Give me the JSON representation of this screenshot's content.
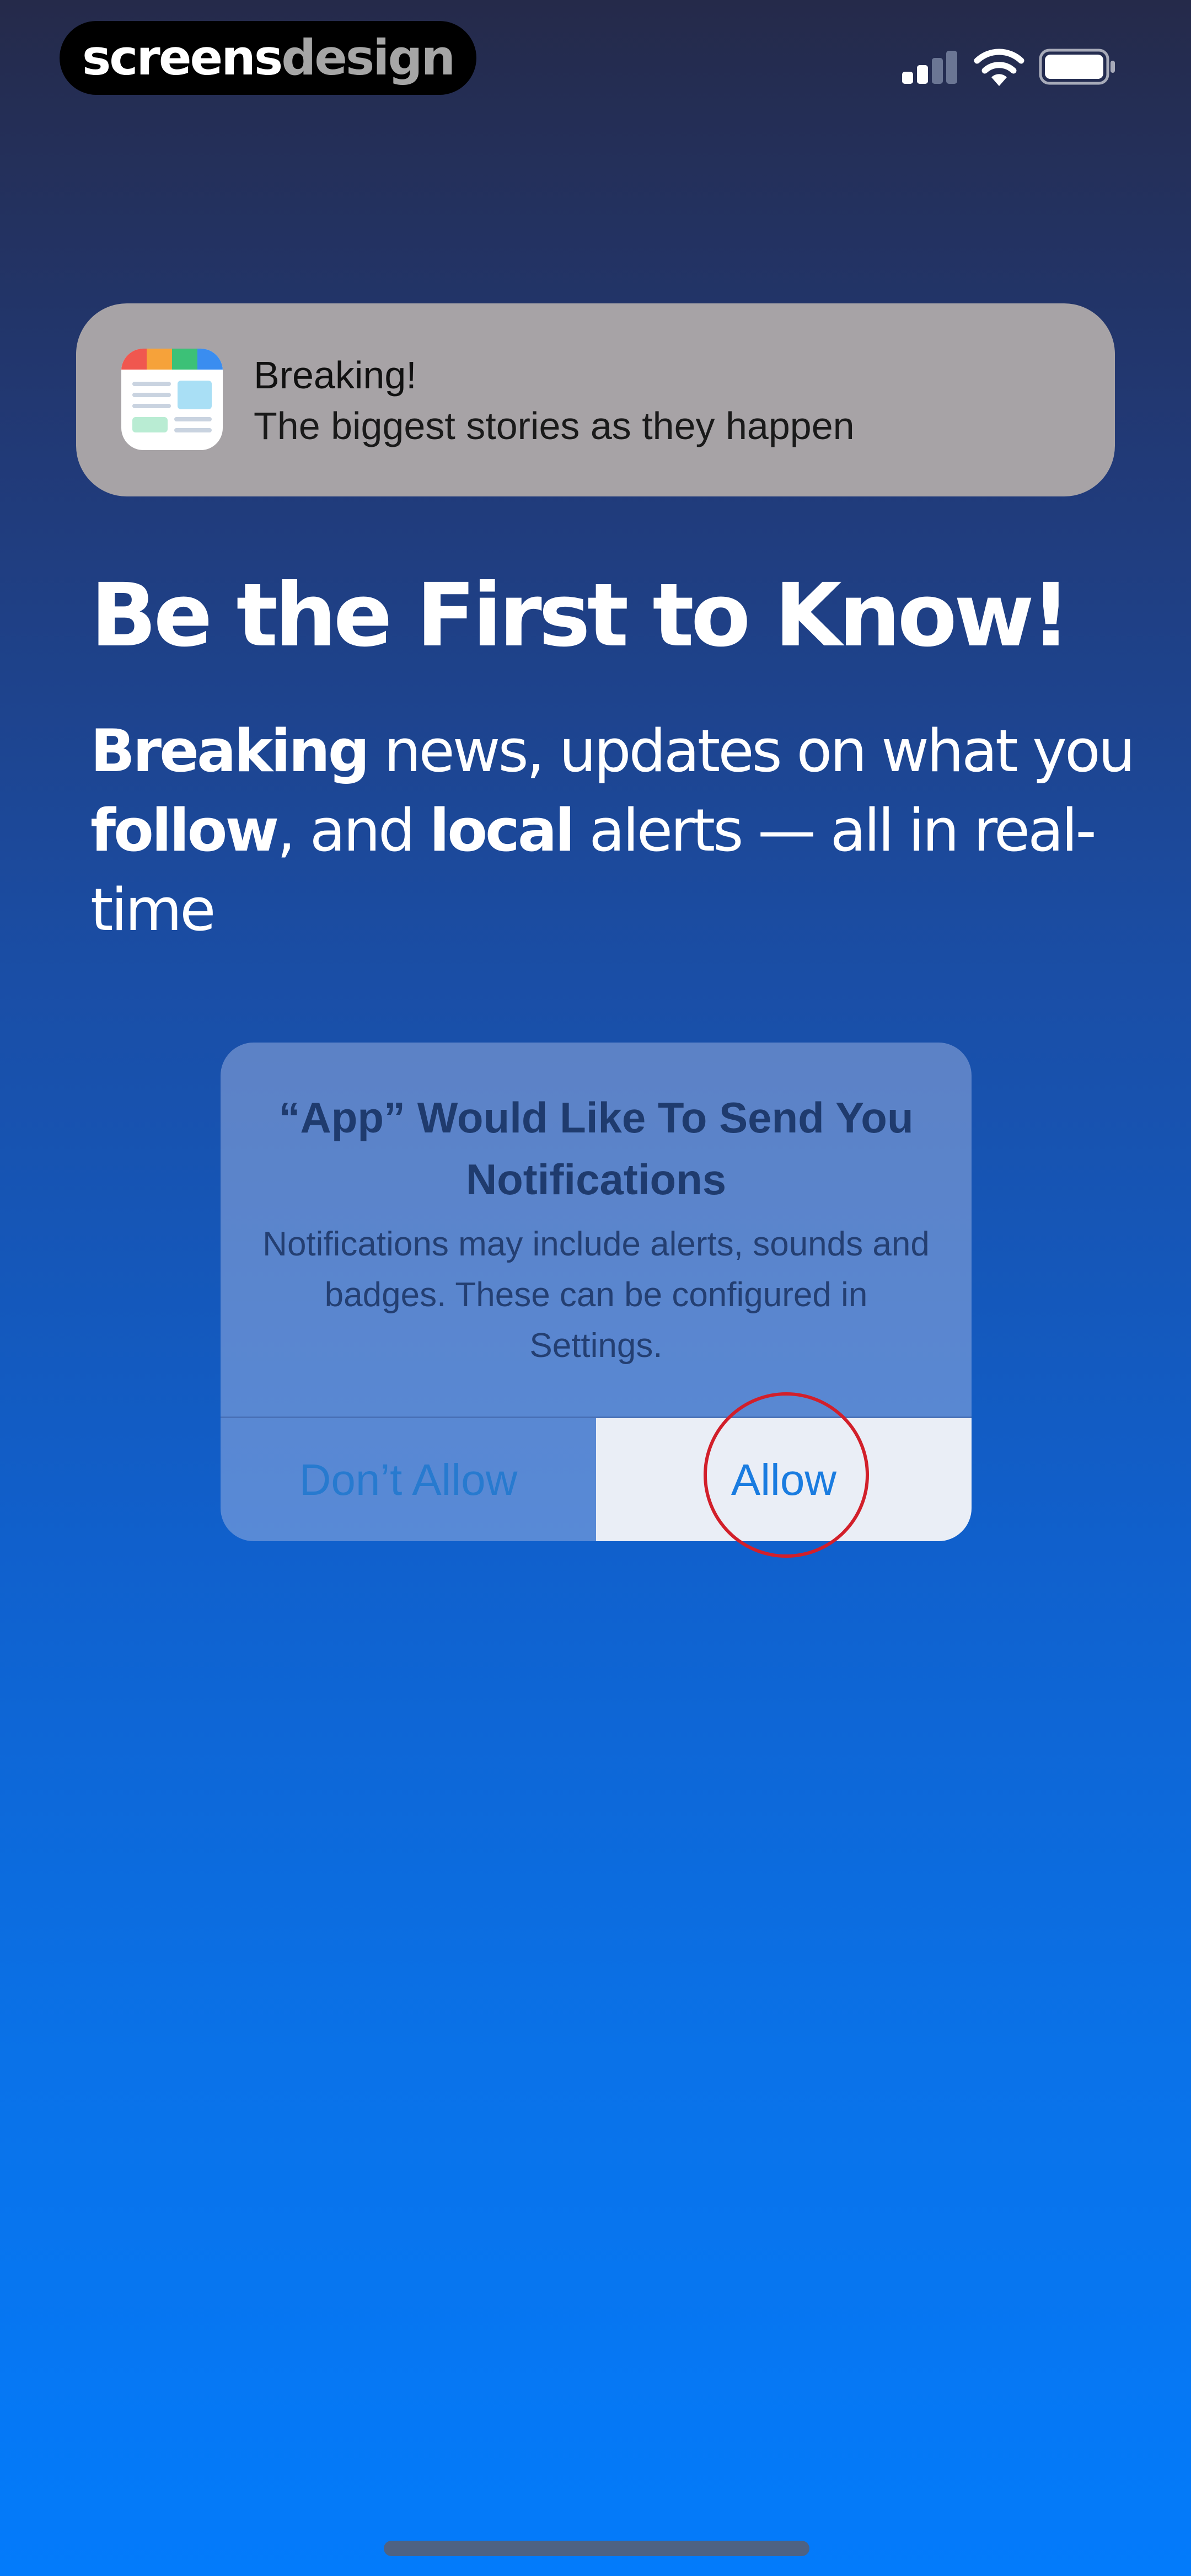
{
  "status_bar": {
    "brand_part_1": "screens",
    "brand_part_2": "design",
    "icons": [
      "signal-icon",
      "wifi-icon",
      "battery-icon"
    ]
  },
  "notification": {
    "icon": "news-app-icon",
    "title": "Breaking!",
    "body": "The biggest stories as they happen"
  },
  "headline": "Be the First to Know!",
  "subheadline": {
    "word_1": "Breaking",
    "text_1": " news, updates on what you ",
    "word_2": "follow",
    "text_2": ", and ",
    "word_3": "local",
    "text_3": " alerts — all in real-time"
  },
  "alert": {
    "title": "“App” Would Like To Send You Notifications",
    "message": "Notifications may include alerts, sounds and badges. These can be configured in Settings.",
    "dont_allow_label": "Don’t Allow",
    "allow_label": "Allow"
  },
  "colors": {
    "background_top": "#252a4a",
    "background_bottom": "#037bfb",
    "highlight_circle": "#d21f2a",
    "button_text": "#1a7ce0"
  }
}
